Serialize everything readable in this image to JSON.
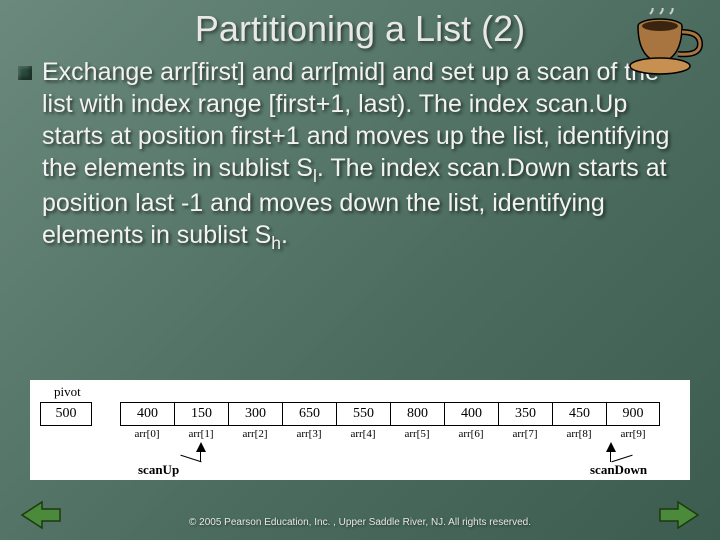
{
  "title": "Partitioning a List (2)",
  "body_parts": {
    "p1": "Exchange arr[first] and arr[mid] and set up a scan of the list with index range [first+1, last). The index scan.Up starts at position first+1 and moves up the list, identifying the elements in sublist S",
    "sub1": "l",
    "p2": ". The index scan.Down starts at position last -1 and moves down the list, identifying elements in sublist S",
    "sub2": "h",
    "p3": "."
  },
  "diagram": {
    "pivot_label": "pivot",
    "pivot_value": "500",
    "cells": [
      "400",
      "150",
      "300",
      "650",
      "550",
      "800",
      "400",
      "350",
      "450",
      "900"
    ],
    "labels": [
      "arr[0]",
      "arr[1]",
      "arr[2]",
      "arr[3]",
      "arr[4]",
      "arr[5]",
      "arr[6]",
      "arr[7]",
      "arr[8]",
      "arr[9]"
    ],
    "scanup": "scanUp",
    "scandown": "scanDown"
  },
  "footer": "© 2005 Pearson Education, Inc. , Upper Saddle River, NJ.  All rights reserved."
}
